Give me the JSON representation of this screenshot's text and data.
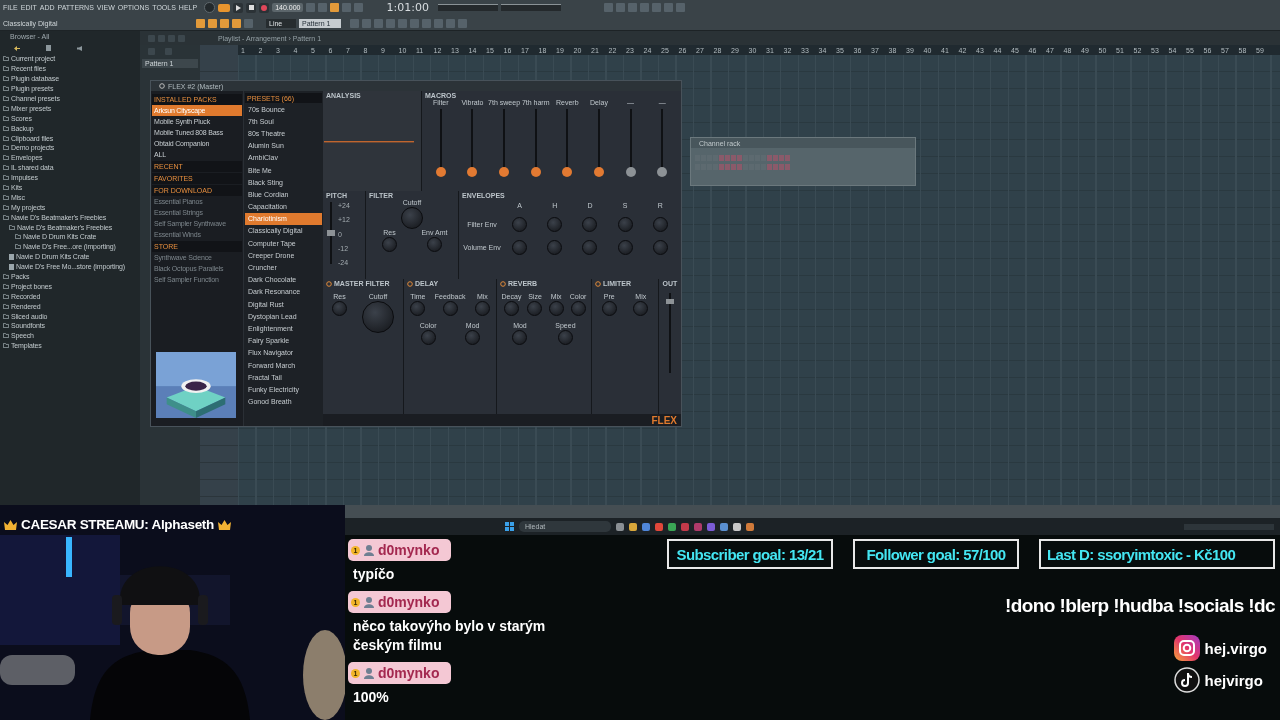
{
  "menu": [
    "FILE",
    "EDIT",
    "ADD",
    "PATTERNS",
    "VIEW",
    "OPTIONS",
    "TOOLS",
    "HELP"
  ],
  "transport": {
    "pattern_mode": true,
    "tempo": "140.000",
    "time": "1:01:00",
    "hint": "Classically Digital",
    "snap": "Line",
    "pattern": "Pattern 1"
  },
  "browser": {
    "title": "Browser - All",
    "items": [
      {
        "kind": "folder",
        "label": "Current project"
      },
      {
        "kind": "folder",
        "label": "Recent files"
      },
      {
        "kind": "folder",
        "label": "Plugin database"
      },
      {
        "kind": "folder",
        "label": "Plugin presets"
      },
      {
        "kind": "folder",
        "label": "Channel presets"
      },
      {
        "kind": "folder",
        "label": "Mixer presets"
      },
      {
        "kind": "folder",
        "label": "Scores"
      },
      {
        "kind": "folder",
        "label": "Backup"
      },
      {
        "kind": "folder",
        "label": "Clipboard files"
      },
      {
        "kind": "folder",
        "label": "Demo projects"
      },
      {
        "kind": "folder",
        "label": "Envelopes"
      },
      {
        "kind": "folder",
        "label": "IL shared data"
      },
      {
        "kind": "folder",
        "label": "Impulses"
      },
      {
        "kind": "folder",
        "label": "Kits"
      },
      {
        "kind": "folder",
        "label": "Misc"
      },
      {
        "kind": "folder",
        "label": "My projects"
      },
      {
        "kind": "folder",
        "label": "Navie D's Beatmaker's Freebies",
        "children": [
          {
            "kind": "folder",
            "label": "Navie D's Beatmaker's Freebies",
            "children": [
              {
                "kind": "folder",
                "label": "Navie D Drum Kits Crate"
              },
              {
                "kind": "folder",
                "label": "Navie D's Free...ore (importing)"
              }
            ]
          },
          {
            "kind": "file",
            "label": "Navie D Drum Kits Crate"
          },
          {
            "kind": "file",
            "label": "Navie D's Free Mo...store (importing)"
          }
        ]
      },
      {
        "kind": "folder",
        "label": "Packs"
      },
      {
        "kind": "folder",
        "label": "Project bones"
      },
      {
        "kind": "folder",
        "label": "Recorded"
      },
      {
        "kind": "folder",
        "label": "Rendered"
      },
      {
        "kind": "folder",
        "label": "Sliced audio"
      },
      {
        "kind": "folder",
        "label": "Soundfonts"
      },
      {
        "kind": "folder",
        "label": "Speech"
      },
      {
        "kind": "folder",
        "label": "Templates"
      }
    ]
  },
  "playlist": {
    "breadcrumb": "Playlist - Arrangement › Pattern 1",
    "patterns": [
      "Pattern 1"
    ],
    "bars": [
      "1",
      "2",
      "3",
      "4",
      "5",
      "6",
      "7",
      "8",
      "9",
      "10",
      "11",
      "12",
      "13",
      "14",
      "15",
      "16",
      "17",
      "18",
      "19",
      "20",
      "21",
      "22",
      "23",
      "24",
      "25",
      "26",
      "27",
      "28",
      "29",
      "30",
      "31",
      "32",
      "33",
      "34",
      "35",
      "36",
      "37",
      "38",
      "39",
      "40",
      "41",
      "42",
      "43",
      "44",
      "45",
      "46",
      "47",
      "48",
      "49",
      "50",
      "51",
      "52",
      "53",
      "54",
      "55",
      "56",
      "57",
      "58",
      "59"
    ]
  },
  "flex": {
    "title": "FLEX #2 (Master)",
    "packs": [
      {
        "kind": "header",
        "label": "INSTALLED PACKS"
      },
      {
        "kind": "pack",
        "label": "Arksun Cityscape",
        "selected": true
      },
      {
        "kind": "pack",
        "label": "Mobile Synth Pluck",
        "selected": false
      },
      {
        "kind": "pack",
        "label": "Mobile Tuned 808 Bass",
        "selected": false
      },
      {
        "kind": "pack",
        "label": "Obtaid Companion",
        "selected": false
      },
      {
        "kind": "pack",
        "label": "ALL",
        "selected": false
      },
      {
        "kind": "header",
        "label": "RECENT"
      },
      {
        "kind": "header",
        "label": "FAVORITES"
      },
      {
        "kind": "header",
        "label": "FOR DOWNLOAD"
      },
      {
        "kind": "download",
        "label": "Essential Pianos",
        "selected": false
      },
      {
        "kind": "download",
        "label": "Essential Strings",
        "selected": false
      },
      {
        "kind": "download",
        "label": "Self Sampler Synthwave",
        "selected": false
      },
      {
        "kind": "download",
        "label": "Essential Winds",
        "selected": false
      },
      {
        "kind": "header",
        "label": "STORE"
      },
      {
        "kind": "store",
        "label": "Synthwave Science",
        "selected": false
      },
      {
        "kind": "store",
        "label": "Black Octopus Parallels",
        "selected": false
      },
      {
        "kind": "store",
        "label": "Self Sampler Function",
        "selected": false
      }
    ],
    "presets_header": "PRESETS (66)",
    "presets": [
      {
        "label": "70s Bounce",
        "selected": false
      },
      {
        "label": "7th Soul",
        "selected": false
      },
      {
        "label": "80s Theatre",
        "selected": false
      },
      {
        "label": "Alumin Sun",
        "selected": false
      },
      {
        "label": "AmbiClav",
        "selected": false
      },
      {
        "label": "Bite Me",
        "selected": false
      },
      {
        "label": "Black Sting",
        "selected": false
      },
      {
        "label": "Blue Cordian",
        "selected": false
      },
      {
        "label": "Capacitation",
        "selected": false
      },
      {
        "label": "Chariotinism",
        "selected": true
      },
      {
        "label": "Classically Digital",
        "selected": false
      },
      {
        "label": "Computer Tape",
        "selected": false
      },
      {
        "label": "Creeper Drone",
        "selected": false
      },
      {
        "label": "Cruncher",
        "selected": false
      },
      {
        "label": "Dark Chocolate",
        "selected": false
      },
      {
        "label": "Dark Resonance",
        "selected": false
      },
      {
        "label": "Digital Rust",
        "selected": false
      },
      {
        "label": "Dystopian Lead",
        "selected": false
      },
      {
        "label": "Enlightenment",
        "selected": false
      },
      {
        "label": "Fairy Sparkle",
        "selected": false
      },
      {
        "label": "Flux Navigator",
        "selected": false
      },
      {
        "label": "Forward March",
        "selected": false
      },
      {
        "label": "Fractal Tail",
        "selected": false
      },
      {
        "label": "Funky Electricity",
        "selected": false
      },
      {
        "label": "Gonod Breath",
        "selected": false
      }
    ],
    "analysis": "ANALYSIS",
    "macros_title": "MACROS",
    "macros": [
      {
        "label": "Filter",
        "level": 0,
        "active": true
      },
      {
        "label": "Vibrato",
        "level": 0,
        "active": true
      },
      {
        "label": "7th sweep",
        "level": 0,
        "active": true
      },
      {
        "label": "7th harm",
        "level": 0,
        "active": true
      },
      {
        "label": "Reverb",
        "level": 0,
        "active": true
      },
      {
        "label": "Delay",
        "level": 0,
        "active": true
      },
      {
        "label": "—",
        "level": 0,
        "active": false
      },
      {
        "label": "—",
        "level": 0,
        "active": false
      }
    ],
    "pitch": {
      "title": "PITCH",
      "level": 0.5,
      "scale": [
        "+24",
        "+12",
        "0",
        "-12",
        "-24"
      ]
    },
    "filter": {
      "title": "FILTER",
      "knobs": [
        "Cutoff",
        "Res",
        "Env Amt"
      ]
    },
    "envelopes": {
      "title": "ENVELOPES",
      "stages": [
        "A",
        "H",
        "D",
        "S",
        "R"
      ],
      "rows": [
        "Filter Env",
        "Volume Env"
      ]
    },
    "effects": [
      {
        "title": "MASTER FILTER",
        "knobs": [
          "Res",
          "Cutoff"
        ]
      },
      {
        "title": "DELAY",
        "knobs": [
          "Time",
          "Feedback",
          "Mix",
          "Color",
          "Mod"
        ]
      },
      {
        "title": "REVERB",
        "knobs": [
          "Decay",
          "Size",
          "Mix",
          "Color",
          "Mod",
          "Speed"
        ]
      },
      {
        "title": "LIMITER",
        "knobs": [
          "Pre",
          "Mix"
        ]
      }
    ],
    "output": {
      "label": "OUT",
      "level": 0.92
    },
    "logo": "FLEX"
  },
  "channel_rack": {
    "title": "Channel rack"
  },
  "taskbar": {
    "search": {
      "placeholder": "Hledat"
    }
  },
  "stream": {
    "banner": "CAESAR STREAMU: Alphaseth",
    "chat": [
      {
        "badge": "1",
        "user": "d0mynko",
        "text": "typíčo"
      },
      {
        "badge": "1",
        "user": "d0mynko",
        "text": "něco takovýho bylo v starým českým filmu"
      },
      {
        "badge": "1",
        "user": "d0mynko",
        "text": "100%"
      }
    ],
    "goals": [
      "Subscriber goal: 13/21",
      "Follower goal: 57/100",
      "Last D: ssoryimtoxic - Kč100"
    ],
    "commands": "!dono !blerp !hudba !socials !dc",
    "socials": [
      {
        "kind": "instagram",
        "handle": "hej.virgo"
      },
      {
        "kind": "tiktok",
        "handle": "hejvirgo"
      }
    ]
  }
}
